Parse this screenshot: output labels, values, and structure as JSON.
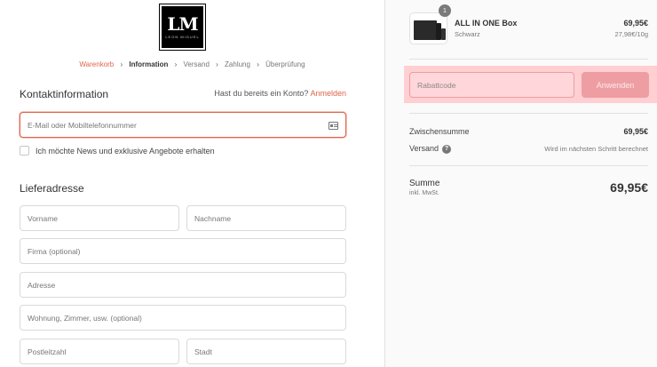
{
  "logo": {
    "mono": "LM",
    "sub": "LEON MIGUEL"
  },
  "breadcrumb": [
    {
      "label": "Warenkorb",
      "state": "link"
    },
    {
      "label": "Information",
      "state": "current"
    },
    {
      "label": "Versand",
      "state": "upcoming"
    },
    {
      "label": "Zahlung",
      "state": "upcoming"
    },
    {
      "label": "Überprüfung",
      "state": "upcoming"
    }
  ],
  "contact": {
    "title": "Kontaktinformation",
    "login_prompt": "Hast du bereits ein Konto?",
    "login_link": "Anmelden",
    "email_placeholder": "E-Mail oder Mobiltelefonnummer",
    "newsletter_label": "Ich möchte News und exklusive Angebote erhalten"
  },
  "shipping": {
    "title": "Lieferadresse",
    "first_name_placeholder": "Vorname",
    "last_name_placeholder": "Nachname",
    "company_placeholder": "Firma (optional)",
    "address_placeholder": "Adresse",
    "apartment_placeholder": "Wohnung, Zimmer, usw. (optional)",
    "postal_placeholder": "Postleitzahl",
    "city_placeholder": "Stadt"
  },
  "order": {
    "item": {
      "quantity": "1",
      "name": "ALL IN ONE Box",
      "variant": "Schwarz",
      "price": "69,95€",
      "unit_price": "27,98€/10g"
    },
    "discount_placeholder": "Rabattcode",
    "apply_label": "Anwenden",
    "subtotal_label": "Zwischensumme",
    "subtotal_value": "69,95€",
    "shipping_label": "Versand",
    "shipping_value": "Wird im nächsten Schritt berechnet",
    "total_label": "Summe",
    "total_sub": "inkl. MwSt.",
    "total_value": "69,95€"
  },
  "colors": {
    "accent": "#e0654a",
    "highlight": "#ffcfd2",
    "button_disabled": "#ee9ea3"
  }
}
